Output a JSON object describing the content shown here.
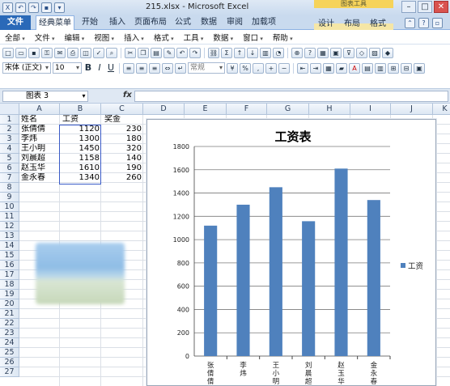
{
  "window": {
    "title": "215.xlsx - Microsoft Excel",
    "context_tab_group": "图表工具"
  },
  "ribbon_tabs": [
    "文件",
    "经典菜单",
    "开始",
    "插入",
    "页面布局",
    "公式",
    "数据",
    "审阅",
    "加载项",
    "设计",
    "布局",
    "格式"
  ],
  "menu": [
    "全部",
    "文件",
    "编辑",
    "视图",
    "插入",
    "格式",
    "工具",
    "数据",
    "窗口",
    "帮助"
  ],
  "toolbar": {
    "font_name": "宋体 (正文)",
    "font_size": "10",
    "number_format": "常规",
    "bold": "B",
    "italic": "I",
    "underline": "U"
  },
  "formula_bar": {
    "name_box": "图表 3",
    "fx": "fx",
    "content": ""
  },
  "columns": [
    "A",
    "B",
    "C",
    "D",
    "E",
    "F",
    "G",
    "H",
    "I",
    "J",
    "K"
  ],
  "rows": [
    "1",
    "2",
    "3",
    "4",
    "5",
    "6",
    "7",
    "8",
    "9",
    "10",
    "11",
    "12",
    "13",
    "14",
    "15",
    "16",
    "17",
    "18",
    "19",
    "20",
    "21",
    "22",
    "23",
    "24",
    "25",
    "26",
    "27"
  ],
  "sheet": {
    "header": [
      "姓名",
      "工资",
      "奖金"
    ],
    "rows": [
      [
        "张倩倩",
        "1120",
        "230"
      ],
      [
        "李炜",
        "1300",
        "180"
      ],
      [
        "王小明",
        "1450",
        "320"
      ],
      [
        "刘晨超",
        "1158",
        "140"
      ],
      [
        "赵玉华",
        "1610",
        "190"
      ],
      [
        "金永春",
        "1340",
        "260"
      ]
    ]
  },
  "colors": {
    "bar": "#4f81bd",
    "selection": "#3a5bc7",
    "file_tab": "#2a69b8"
  },
  "chart_data": {
    "type": "bar",
    "title": "工资表",
    "categories": [
      "张倩倩",
      "李炜",
      "王小明",
      "刘晨超",
      "赵玉华",
      "金永春"
    ],
    "series": [
      {
        "name": "工资",
        "values": [
          1120,
          1300,
          1450,
          1158,
          1610,
          1340
        ]
      }
    ],
    "ylim": [
      0,
      1800
    ],
    "yticks": [
      0,
      200,
      400,
      600,
      800,
      1000,
      1200,
      1400,
      1600,
      1800
    ],
    "grid": true,
    "legend": "right"
  }
}
